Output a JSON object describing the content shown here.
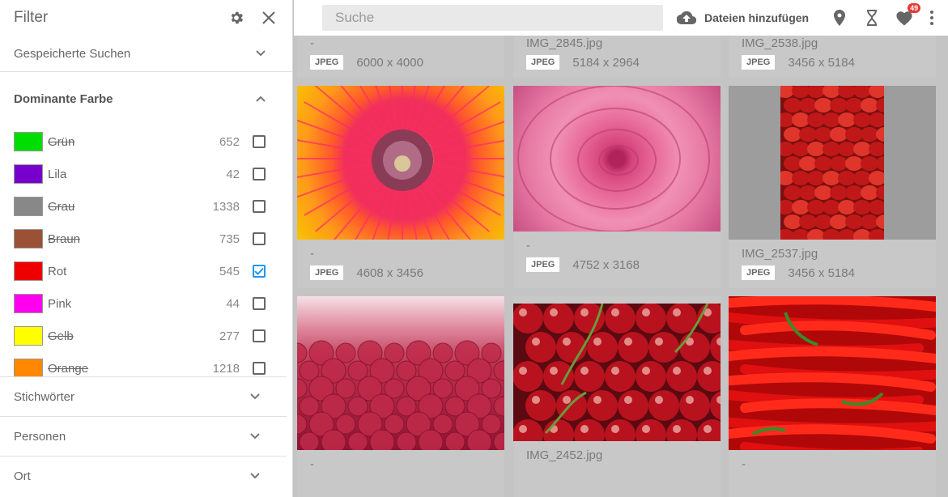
{
  "sidebar": {
    "title": "Filter",
    "saved_searches": "Gespeicherte Suchen",
    "dominant_color": "Dominante Farbe",
    "colors": [
      {
        "name": "Grün",
        "count": "652",
        "hex": "#00dd00",
        "struck": true,
        "checked": false
      },
      {
        "name": "Lila",
        "count": "42",
        "hex": "#7700cc",
        "struck": false,
        "checked": false
      },
      {
        "name": "Grau",
        "count": "1338",
        "hex": "#888888",
        "struck": true,
        "checked": false
      },
      {
        "name": "Braun",
        "count": "735",
        "hex": "#9a5136",
        "struck": true,
        "checked": false
      },
      {
        "name": "Rot",
        "count": "545",
        "hex": "#ee0000",
        "struck": false,
        "checked": true
      },
      {
        "name": "Pink",
        "count": "44",
        "hex": "#ff00ee",
        "struck": false,
        "checked": false
      },
      {
        "name": "Gelb",
        "count": "277",
        "hex": "#ffff00",
        "struck": true,
        "checked": false
      },
      {
        "name": "Orange",
        "count": "1218",
        "hex": "#ff8800",
        "struck": true,
        "checked": false
      }
    ],
    "keywords": "Stichwörter",
    "persons": "Personen",
    "location": "Ort"
  },
  "topbar": {
    "search_placeholder": "Suche",
    "add_files": "Dateien hinzufügen",
    "favorites_badge": "49"
  },
  "cards": [
    {
      "fname": "-",
      "type": "JPEG",
      "dims": "6000 x 4000",
      "image": "none"
    },
    {
      "fname": "IMG_2845.jpg",
      "type": "JPEG",
      "dims": "5184 x 2964",
      "image": "none"
    },
    {
      "fname": "IMG_2538.jpg",
      "type": "JPEG",
      "dims": "3456 x 5184",
      "image": "none"
    },
    {
      "fname": "-",
      "type": "JPEG",
      "dims": "4608 x 3456",
      "image": "poppy"
    },
    {
      "fname": "-",
      "type": "JPEG",
      "dims": "4752 x 3168",
      "image": "rose"
    },
    {
      "fname": "IMG_2537.jpg",
      "type": "JPEG",
      "dims": "3456 x 5184",
      "image": "tomatoes"
    },
    {
      "fname": "-",
      "type": "",
      "dims": "",
      "image": "raspberries"
    },
    {
      "fname": "IMG_2452.jpg",
      "type": "",
      "dims": "",
      "image": "cherries"
    },
    {
      "fname": "-",
      "type": "",
      "dims": "",
      "image": "chilis"
    }
  ],
  "colors": {
    "checkbox_checked": "#2196f3",
    "badge": "#e53935"
  }
}
